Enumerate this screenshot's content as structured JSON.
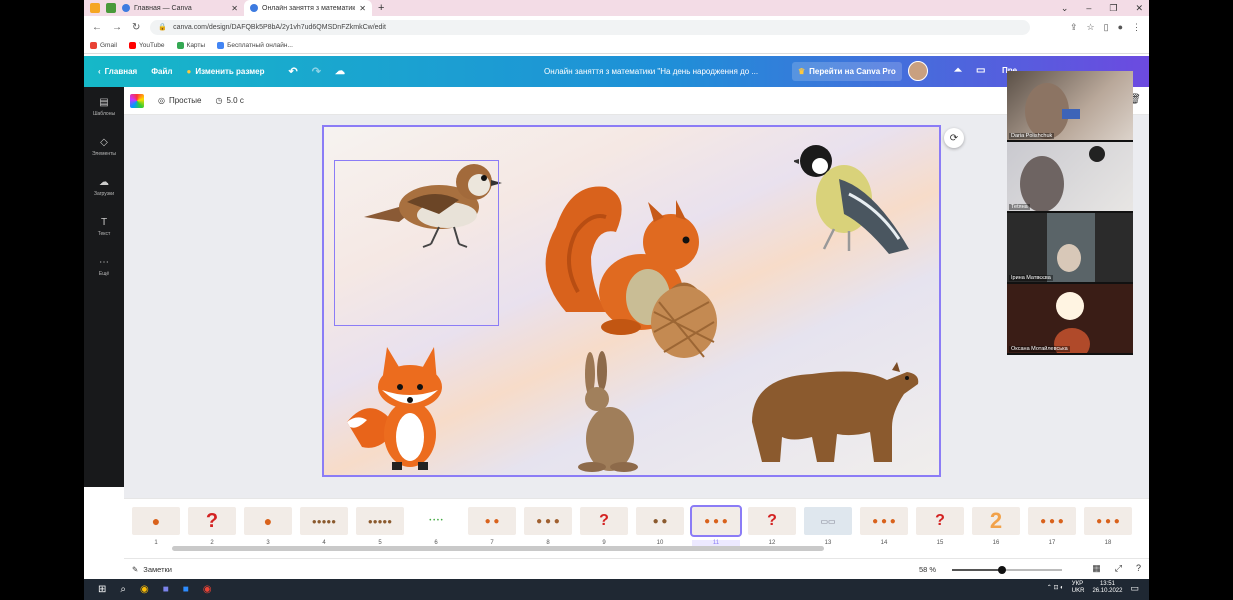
{
  "browser": {
    "tabs": [
      {
        "title": "Главная — Canva"
      },
      {
        "title": "Онлайн заняття з математики \""
      }
    ],
    "url": "canva.com/design/DAFQBk5P8bA/2y1vh7ud6QMSDnFZkmkCw/edit",
    "bookmarks": [
      "Gmail",
      "YouTube",
      "Карты",
      "Бесплатный онлайн..."
    ]
  },
  "canva": {
    "home_label": "Главная",
    "file_label": "Файл",
    "resize_label": "Изменить размер",
    "doc_title": "Онлайн заняття з математики \"На день народження до ...",
    "pro_label": "Перейти на Canva Pro",
    "share_label": "Пре"
  },
  "rail": [
    "Шаблоны",
    "Элементы",
    "Загрузки",
    "Текст",
    "Ещё"
  ],
  "toolbar": {
    "animation": "Простые",
    "duration": "5.0 с"
  },
  "video": [
    {
      "name": "Daria Polishchuk"
    },
    {
      "name": "Теtяна"
    },
    {
      "name": "Ірина Матвєєва"
    },
    {
      "name": "Оксана Мотайлевська"
    }
  ],
  "thumbnails": [
    "1",
    "2",
    "3",
    "4",
    "5",
    "6",
    "7",
    "8",
    "9",
    "10",
    "11",
    "12",
    "13",
    "14",
    "15",
    "16",
    "17",
    "18"
  ],
  "current_slide": "11",
  "bottom": {
    "notes": "Заметки",
    "zoom": "58 %",
    "zoom_level": 0.45
  },
  "taskbar": {
    "lang1": "УКР",
    "lang2": "UKR",
    "time": "13:51",
    "date": "26.10.2022"
  }
}
